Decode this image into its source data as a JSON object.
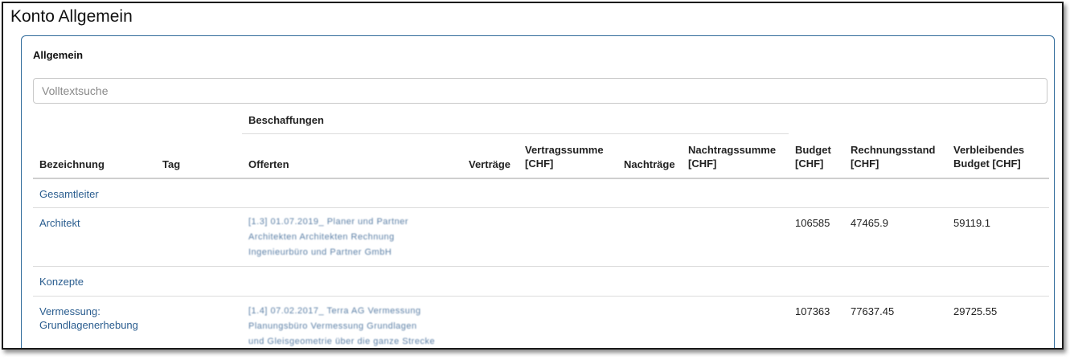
{
  "window": {
    "title": "Konto Allgemein"
  },
  "panel": {
    "title": "Allgemein"
  },
  "search": {
    "placeholder": "Volltextsuche",
    "value": ""
  },
  "table": {
    "group_header": "Beschaffungen",
    "headers": {
      "bezeichnung": "Bezeichnung",
      "tag": "Tag",
      "offerten": "Offerten",
      "vertraege": "Verträge",
      "vertragssumme_1": "Vertragssumme",
      "vertragssumme_2": "[CHF]",
      "nachtraege": "Nachträge",
      "nachtragssumme_1": "Nachtragssumme",
      "nachtragssumme_2": "[CHF]",
      "budget_1": "Budget",
      "budget_2": "[CHF]",
      "rechnungsstand_1": "Rechnungsstand",
      "rechnungsstand_2": "[CHF]",
      "verbleibend_1": "Verbleibendes",
      "verbleibend_2": "Budget [CHF]"
    },
    "rows": [
      {
        "bezeichnung": "Gesamtleiter"
      },
      {
        "bezeichnung": "Architekt",
        "offerten": [
          "[1.3] 01.07.2019_ Planer und Partner",
          "Architekten Architekten Rechnung",
          "Ingenieurbüro und Partner GmbH"
        ],
        "budget": "106585",
        "rechnungsstand": "47465.9",
        "verbleibend": "59119.1"
      },
      {
        "bezeichnung": "Konzepte"
      },
      {
        "bezeichnung_1": "Vermessung:",
        "bezeichnung_2": "Grundlagenerhebung",
        "offerten": [
          "[1.4] 07.02.2017_ Terra AG Vermessung",
          "Planungsbüro Vermessung Grundlagen",
          "und Gleisgeometrie über die ganze Strecke"
        ],
        "budget": "107363",
        "rechnungsstand": "77637.45",
        "verbleibend": "29725.55"
      }
    ]
  }
}
